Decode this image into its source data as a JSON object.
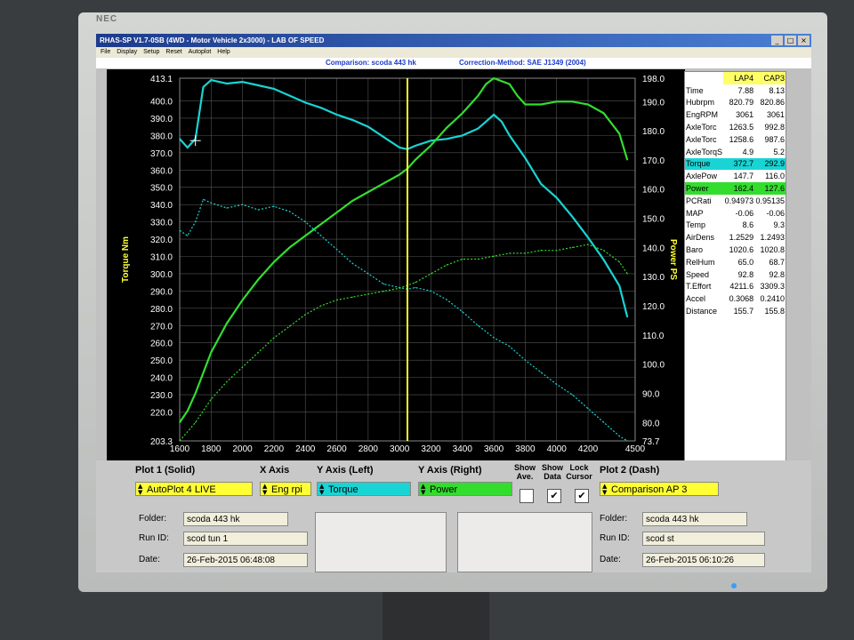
{
  "brand": "NEC",
  "window": {
    "title": "RHAS-SP V1.7-0SB   (4WD - Motor Vehicle 2x3000) - LAB OF SPEED",
    "controls": [
      "_",
      "□",
      "×"
    ]
  },
  "menu": [
    "File",
    "Display",
    "Setup",
    "Reset",
    "Autoplot",
    "Help"
  ],
  "info": {
    "comparison": "Comparison: scoda 443 hk",
    "correction": "Correction-Method: SAE J1349 (2004)"
  },
  "colors": {
    "torque": "#19d4d4",
    "power": "#33dd2e",
    "cursor": "#ffff33",
    "axis_label": "#ffff33"
  },
  "chart_data": {
    "type": "line",
    "xlabel": "",
    "ylabel_left": "Torque Nm",
    "ylabel_right": "Power PS",
    "xlim": [
      1600,
      4500
    ],
    "ylim_left": [
      203.3,
      413.1
    ],
    "ylim_right": [
      73.7,
      198.0
    ],
    "x_ticks": [
      1600,
      1800,
      2000,
      2200,
      2400,
      2600,
      2800,
      3000,
      3200,
      3400,
      3600,
      3800,
      4000,
      4200,
      4500
    ],
    "x_tick_labels": [
      "1600",
      "1800",
      "2000",
      "2200",
      "2400",
      "2600",
      "2800",
      "3000",
      "3200",
      "3400",
      "3600",
      "3800",
      "4000",
      "4200",
      "4500"
    ],
    "y_left_ticks": [
      413.1,
      400,
      390,
      380,
      370,
      360,
      350,
      340,
      330,
      320,
      310,
      300,
      290,
      280,
      270,
      260,
      250,
      240,
      230,
      220,
      203.3
    ],
    "y_left_tick_labels": [
      "413.1",
      "400.0",
      "390.0",
      "380.0",
      "370.0",
      "360.0",
      "350.0",
      "340.0",
      "330.0",
      "320.0",
      "310.0",
      "300.0",
      "290.0",
      "280.0",
      "270.0",
      "260.0",
      "250.0",
      "240.0",
      "230.0",
      "220.0",
      "203.3"
    ],
    "y_right_ticks": [
      198,
      190,
      180,
      170,
      160,
      150,
      140,
      130,
      120,
      110,
      100,
      90,
      80,
      73.7
    ],
    "y_right_tick_labels": [
      "198.0",
      "190.0",
      "180.0",
      "170.0",
      "160.0",
      "150.0",
      "140.0",
      "130.0",
      "120.0",
      "110.0",
      "100.0",
      "90.0",
      "80.0",
      "73.7"
    ],
    "cursor_x": 3050,
    "grid": true,
    "series": [
      {
        "axis": "left",
        "style": "solid",
        "color": "#19d4d4",
        "x": [
          1600,
          1650,
          1700,
          1750,
          1800,
          1900,
          2000,
          2100,
          2200,
          2300,
          2400,
          2500,
          2600,
          2700,
          2800,
          2900,
          3000,
          3050,
          3100,
          3200,
          3300,
          3400,
          3500,
          3550,
          3600,
          3650,
          3700,
          3800,
          3900,
          4000,
          4100,
          4200,
          4300,
          4400,
          4450
        ],
        "y": [
          378,
          373,
          378,
          408,
          412,
          410,
          411,
          409,
          407,
          403,
          399,
          396,
          392,
          389,
          385,
          379,
          373,
          372,
          374,
          377,
          378,
          380,
          384,
          388,
          392,
          388,
          380,
          367,
          352,
          344,
          333,
          321,
          308,
          293,
          275
        ]
      },
      {
        "axis": "right",
        "style": "solid",
        "color": "#33dd2e",
        "x": [
          1600,
          1650,
          1700,
          1800,
          1900,
          2000,
          2100,
          2200,
          2300,
          2400,
          2500,
          2600,
          2700,
          2800,
          2900,
          3000,
          3050,
          3100,
          3200,
          3300,
          3400,
          3500,
          3550,
          3600,
          3650,
          3700,
          3750,
          3800,
          3900,
          4000,
          4100,
          4200,
          4300,
          4400,
          4450
        ],
        "y": [
          80,
          84,
          90,
          104,
          114,
          122,
          129,
          135,
          140,
          144,
          148,
          152,
          156,
          159,
          162,
          165,
          167,
          170,
          175,
          181,
          186,
          192,
          196,
          198,
          197,
          196,
          192,
          189,
          189,
          190,
          190,
          189,
          186,
          179,
          170
        ]
      },
      {
        "axis": "left",
        "style": "dashed",
        "color": "#19d4d4",
        "x": [
          1600,
          1650,
          1700,
          1750,
          1800,
          1900,
          2000,
          2100,
          2200,
          2300,
          2400,
          2500,
          2600,
          2700,
          2800,
          2900,
          3000,
          3050,
          3100,
          3200,
          3300,
          3400,
          3500,
          3600,
          3700,
          3800,
          3900,
          4000,
          4100,
          4200,
          4300,
          4400,
          4450
        ],
        "y": [
          325,
          322,
          330,
          343,
          341,
          338,
          340,
          337,
          339,
          336,
          330,
          322,
          314,
          306,
          300,
          294,
          292,
          291,
          292,
          290,
          285,
          278,
          270,
          263,
          258,
          250,
          243,
          236,
          230,
          222,
          214,
          206,
          203.3
        ]
      },
      {
        "axis": "right",
        "style": "dashed",
        "color": "#33dd2e",
        "x": [
          1600,
          1700,
          1800,
          1900,
          2000,
          2100,
          2200,
          2300,
          2400,
          2500,
          2600,
          2700,
          2800,
          2900,
          3000,
          3050,
          3100,
          3200,
          3300,
          3400,
          3500,
          3600,
          3700,
          3800,
          3900,
          4000,
          4100,
          4200,
          4300,
          4400,
          4450
        ],
        "y": [
          73.7,
          80,
          88,
          94,
          99,
          104,
          109,
          113,
          117,
          120,
          122,
          123,
          124,
          125,
          126,
          127,
          128,
          131,
          134,
          136,
          136,
          137,
          138,
          138,
          139,
          139,
          140,
          141,
          139,
          135,
          131
        ]
      }
    ]
  },
  "side_panel": {
    "headers": [
      "",
      "LAP4",
      "CAP3"
    ],
    "rows": [
      {
        "name": "Time",
        "a": "7.88",
        "b": "8.13",
        "hl": ""
      },
      {
        "name": "Hubrpm",
        "a": "820.79",
        "b": "820.86",
        "hl": ""
      },
      {
        "name": "EngRPM",
        "a": "3061",
        "b": "3061",
        "hl": ""
      },
      {
        "name": "AxleTorc",
        "a": "1263.5",
        "b": "992.8",
        "hl": ""
      },
      {
        "name": "AxleTorc",
        "a": "1258.6",
        "b": "987.6",
        "hl": ""
      },
      {
        "name": "AxleTorqS",
        "a": "4.9",
        "b": "5.2",
        "hl": ""
      },
      {
        "name": "Torque",
        "a": "372.7",
        "b": "292.9",
        "hl": "#19d4d4"
      },
      {
        "name": "AxlePow",
        "a": "147.7",
        "b": "116.0",
        "hl": ""
      },
      {
        "name": "Power",
        "a": "162.4",
        "b": "127.6",
        "hl": "#33dd2e"
      },
      {
        "name": "PCRati",
        "a": "0.94973",
        "b": "0.95135",
        "hl": ""
      },
      {
        "name": "MAP",
        "a": "-0.06",
        "b": "-0.06",
        "hl": ""
      },
      {
        "name": "Temp",
        "a": "8.6",
        "b": "9.3",
        "hl": ""
      },
      {
        "name": "AirDens",
        "a": "1.2529",
        "b": "1.2493",
        "hl": ""
      },
      {
        "name": "Baro",
        "a": "1020.6",
        "b": "1020.8",
        "hl": ""
      },
      {
        "name": "RelHum",
        "a": "65.0",
        "b": "68.7",
        "hl": ""
      },
      {
        "name": "Speed",
        "a": "92.8",
        "b": "92.8",
        "hl": ""
      },
      {
        "name": "T.Effort",
        "a": "4211.6",
        "b": "3309.3",
        "hl": ""
      },
      {
        "name": "Accel",
        "a": "0.3068",
        "b": "0.2410",
        "hl": ""
      },
      {
        "name": "Distance",
        "a": "155.7",
        "b": "155.8",
        "hl": ""
      }
    ]
  },
  "controls": {
    "plot1_label": "Plot 1 (Solid)",
    "plot1_value": "AutoPlot 4 LIVE",
    "xaxis_label": "X Axis",
    "xaxis_value": "Eng rpi",
    "yleft_label": "Y Axis (Left)",
    "yleft_value": "Torque",
    "yright_label": "Y Axis (Right)",
    "yright_value": "Power",
    "show_ave_label": "Show Ave.",
    "show_data_label": "Show Data",
    "lock_cursor_label": "Lock Cursor",
    "show_ave_checked": false,
    "show_data_checked": true,
    "lock_cursor_checked": true,
    "plot2_label": "Plot 2 (Dash)",
    "plot2_value": "Comparison AP 3"
  },
  "run1": {
    "folder_label": "Folder:",
    "folder": "scoda 443 hk",
    "runid_label": "Run ID:",
    "runid": "scod tun 1",
    "date_label": "Date:",
    "date": "26-Feb-2015  06:48:08"
  },
  "run2": {
    "folder_label": "Folder:",
    "folder": "scoda 443 hk",
    "runid_label": "Run ID:",
    "runid": "scod st",
    "date_label": "Date:",
    "date": "26-Feb-2015  06:10:26"
  }
}
